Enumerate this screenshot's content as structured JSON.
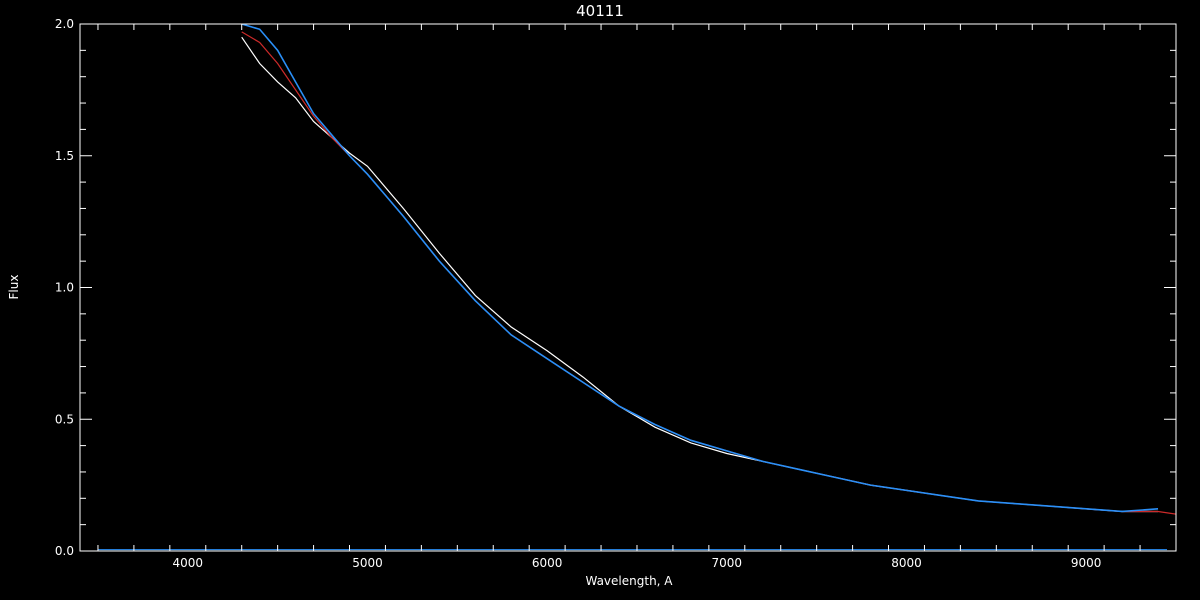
{
  "chart_data": {
    "type": "line",
    "title": "40111",
    "xlabel": "Wavelength, A",
    "ylabel": "Flux",
    "xlim": [
      3400,
      9500
    ],
    "ylim": [
      0.0,
      2.0
    ],
    "x_ticks": [
      4000,
      5000,
      6000,
      7000,
      8000,
      9000
    ],
    "x_tick_labels": [
      "4000",
      "5000",
      "6000",
      "7000",
      "8000",
      "9000"
    ],
    "y_ticks": [
      0.0,
      0.5,
      1.0,
      1.5,
      2.0
    ],
    "y_tick_labels": [
      "0.0",
      "0.5",
      "1.0",
      "1.5",
      "2.0"
    ],
    "grid": false,
    "background": "#000000",
    "axis_color": "#ffffff",
    "series": [
      {
        "color": "#ffffff",
        "x": [
          4300,
          4400,
          4500,
          4600,
          4700,
          4800,
          4900,
          5000,
          5200,
          5400,
          5600,
          5800,
          6000,
          6200,
          6400,
          6600,
          6800,
          7000,
          7200,
          7400,
          7600,
          7800,
          8000,
          8200,
          8400,
          8600,
          8800,
          9000,
          9200,
          9400
        ],
        "y": [
          1.95,
          1.85,
          1.78,
          1.72,
          1.63,
          1.57,
          1.51,
          1.46,
          1.3,
          1.13,
          0.97,
          0.85,
          0.76,
          0.66,
          0.55,
          0.47,
          0.41,
          0.37,
          0.34,
          0.31,
          0.28,
          0.25,
          0.23,
          0.21,
          0.19,
          0.18,
          0.17,
          0.16,
          0.15,
          0.15
        ]
      },
      {
        "color": "#cc2a2a",
        "x": [
          4300,
          4400,
          4500,
          4600,
          4700,
          4800,
          4900,
          5000,
          5200,
          5400,
          5600,
          5800,
          6000,
          6200,
          6400,
          6600,
          6800,
          7000,
          7200,
          7400,
          7600,
          7800,
          8000,
          8200,
          8400,
          8600,
          8800,
          9000,
          9200,
          9400,
          9500
        ],
        "y": [
          1.97,
          1.93,
          1.85,
          1.75,
          1.65,
          1.57,
          1.5,
          1.43,
          1.27,
          1.1,
          0.95,
          0.82,
          0.73,
          0.64,
          0.55,
          0.48,
          0.42,
          0.38,
          0.34,
          0.31,
          0.28,
          0.25,
          0.23,
          0.21,
          0.19,
          0.18,
          0.17,
          0.16,
          0.15,
          0.15,
          0.14
        ]
      },
      {
        "color": "#2a8ff7",
        "x": [
          4300,
          4400,
          4500,
          4600,
          4700,
          4800,
          4900,
          5000,
          5200,
          5400,
          5600,
          5800,
          6000,
          6200,
          6400,
          6600,
          6800,
          7000,
          7200,
          7400,
          7600,
          7800,
          8000,
          8200,
          8400,
          8600,
          8800,
          9000,
          9200,
          9400
        ],
        "y": [
          2.0,
          1.98,
          1.9,
          1.78,
          1.66,
          1.58,
          1.5,
          1.43,
          1.27,
          1.1,
          0.95,
          0.82,
          0.73,
          0.64,
          0.55,
          0.48,
          0.42,
          0.38,
          0.34,
          0.31,
          0.28,
          0.25,
          0.23,
          0.21,
          0.19,
          0.18,
          0.17,
          0.16,
          0.15,
          0.16
        ]
      }
    ]
  }
}
